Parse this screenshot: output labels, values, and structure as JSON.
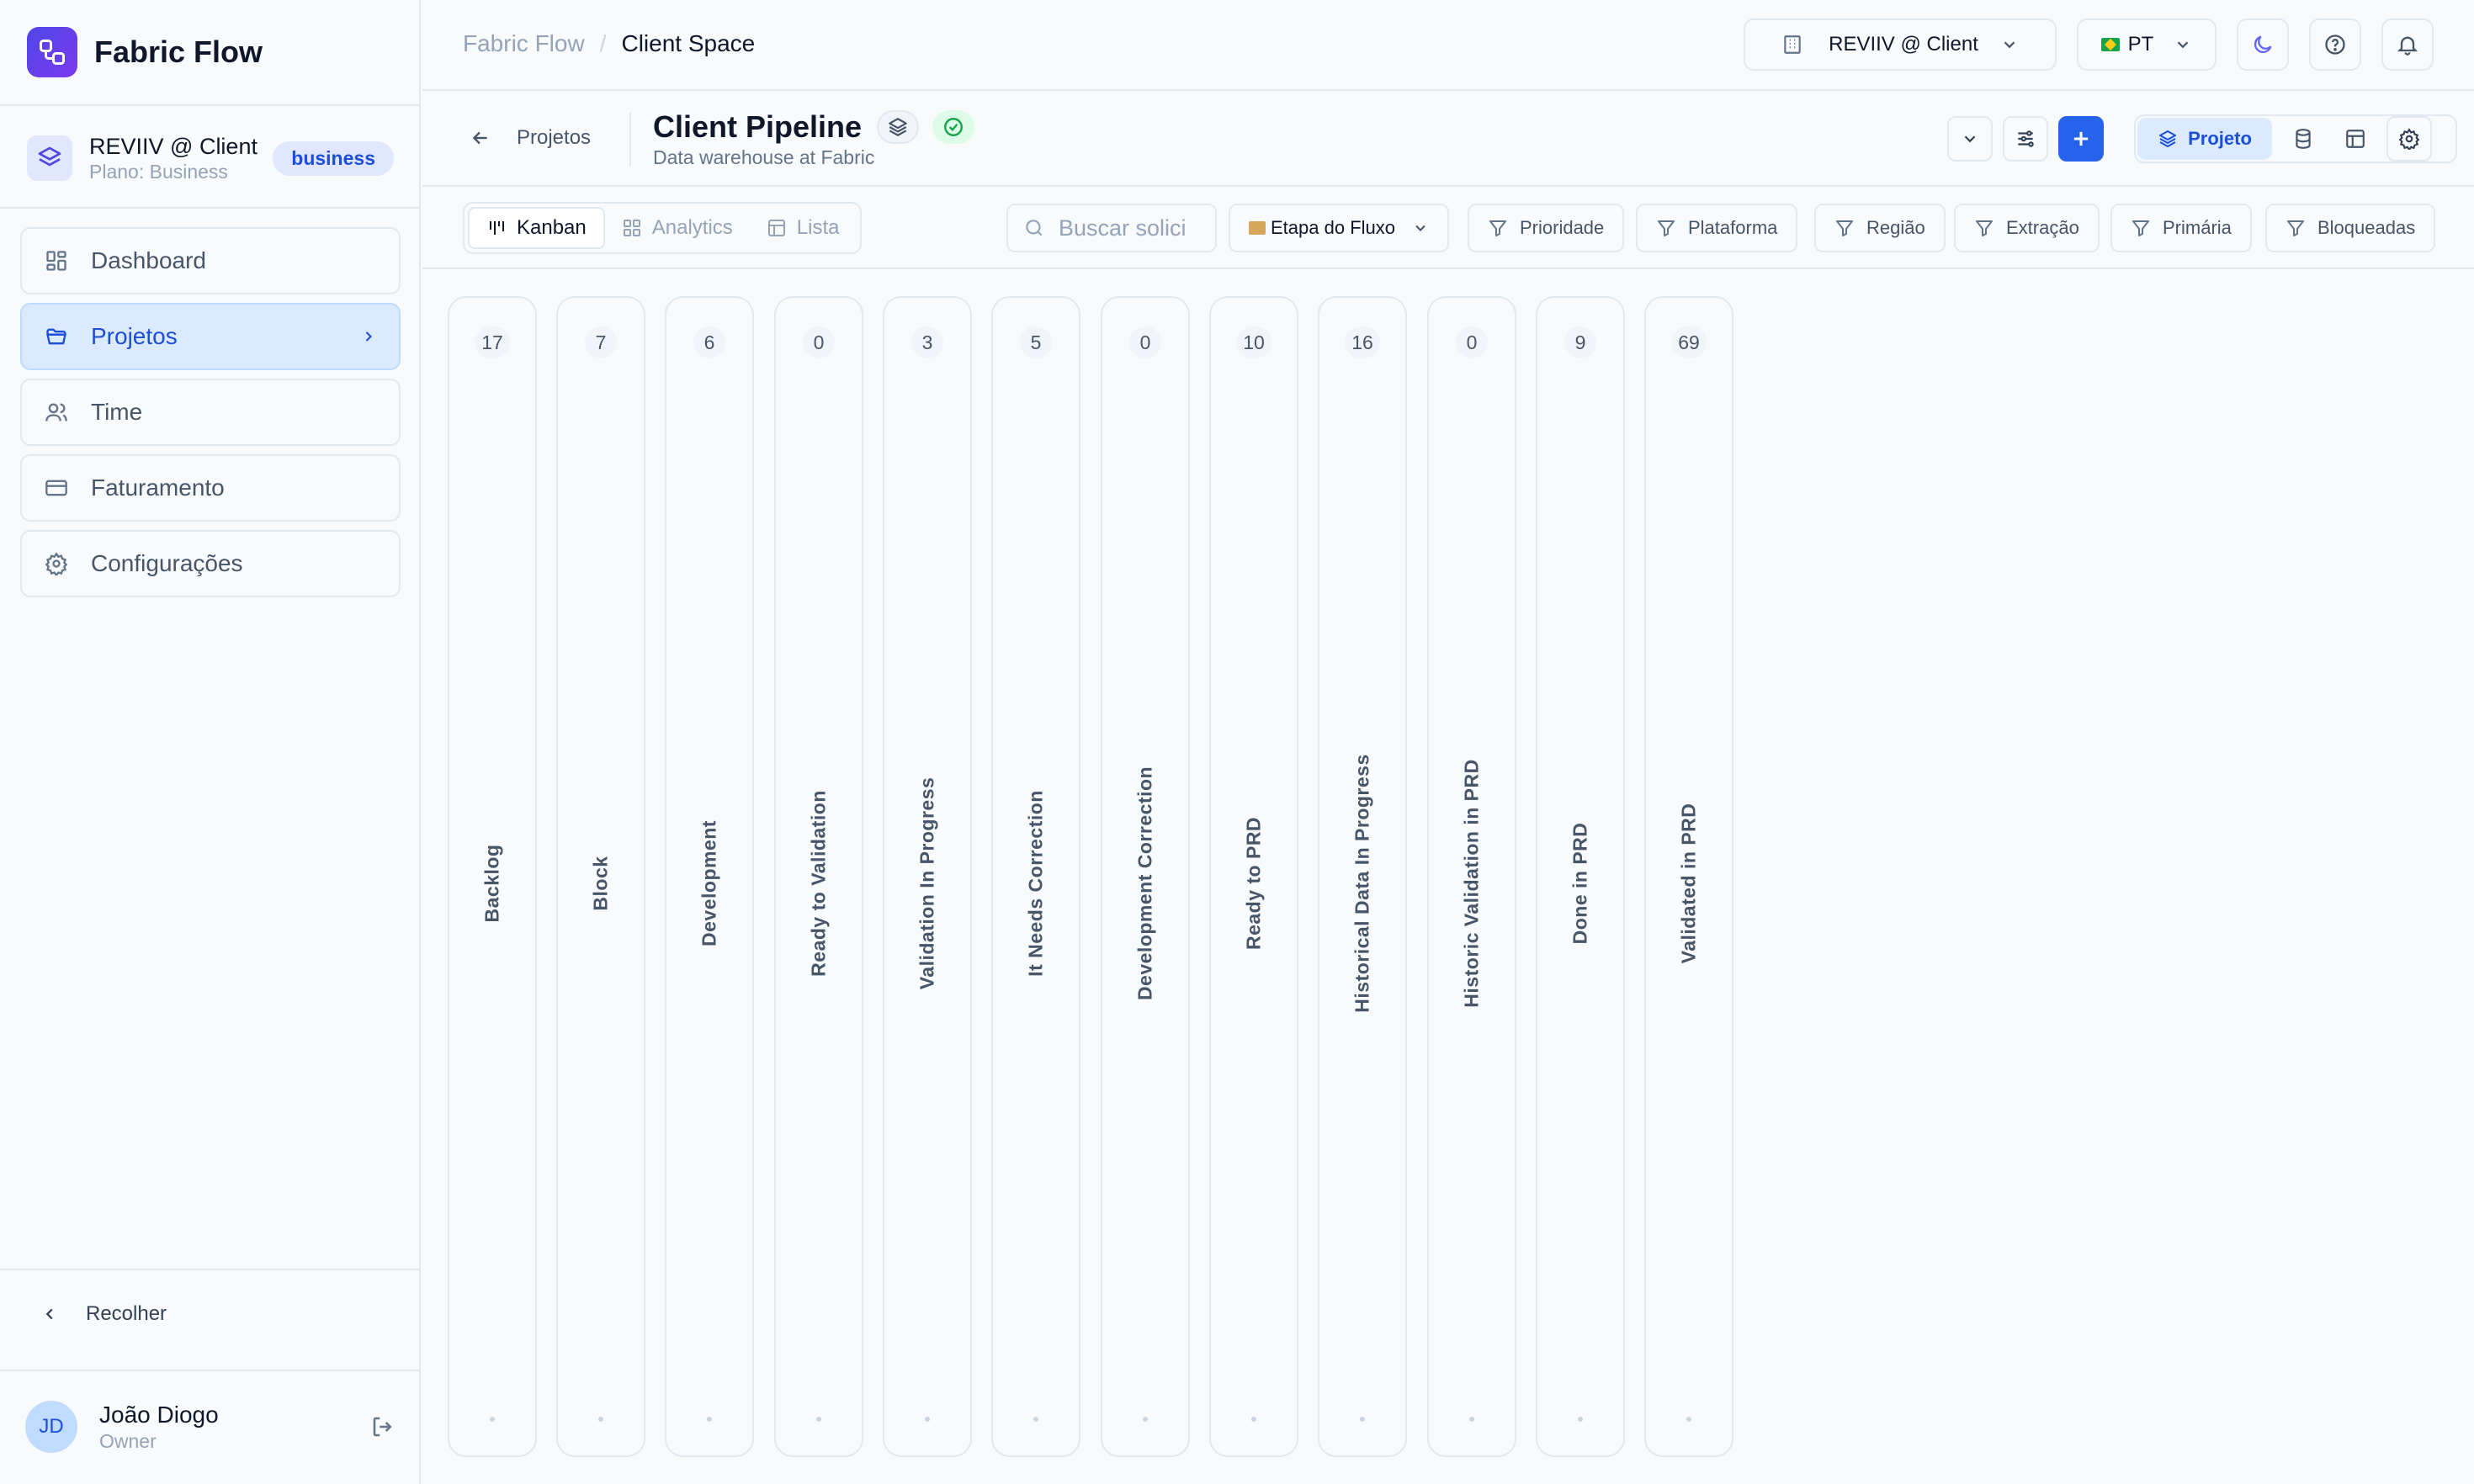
{
  "app": {
    "name": "Fabric Flow"
  },
  "workspace": {
    "name": "REVIIV @ Client",
    "plan": "Plano: Business",
    "badge": "business"
  },
  "sidebar": {
    "items": [
      {
        "label": "Dashboard",
        "icon": "dashboard-icon"
      },
      {
        "label": "Projetos",
        "icon": "folder-icon",
        "active": true
      },
      {
        "label": "Time",
        "icon": "users-icon"
      },
      {
        "label": "Faturamento",
        "icon": "credit-card-icon"
      },
      {
        "label": "Configurações",
        "icon": "gear-icon"
      }
    ],
    "collapse_label": "Recolher"
  },
  "user": {
    "initials": "JD",
    "name": "João Diogo",
    "role": "Owner"
  },
  "topbar": {
    "breadcrumb_root": "Fabric Flow",
    "breadcrumb_separator": "/",
    "breadcrumb_current": "Client Space",
    "workspace_select": "REVIIV @ Client",
    "language_select": "PT"
  },
  "project": {
    "back_label": "Projetos",
    "title": "Client Pipeline",
    "subtitle": "Data warehouse at Fabric",
    "view_mode": "Projeto"
  },
  "views": {
    "tabs": [
      {
        "label": "Kanban",
        "active": true
      },
      {
        "label": "Analytics"
      },
      {
        "label": "Lista"
      }
    ]
  },
  "filters": {
    "search_placeholder": "Buscar solici",
    "stage_select": "Etapa do Fluxo",
    "buttons": [
      "Prioridade",
      "Plataforma",
      "Região",
      "Extração",
      "Primária",
      "Bloqueadas"
    ]
  },
  "kanban": {
    "columns": [
      {
        "name": "Backlog",
        "count": "17"
      },
      {
        "name": "Block",
        "count": "7"
      },
      {
        "name": "Development",
        "count": "6"
      },
      {
        "name": "Ready to Validation",
        "count": "0"
      },
      {
        "name": "Validation In Progress",
        "count": "3"
      },
      {
        "name": "It Needs Correction",
        "count": "5"
      },
      {
        "name": "Development Correction",
        "count": "0"
      },
      {
        "name": "Ready to PRD",
        "count": "10"
      },
      {
        "name": "Historical Data In Progress",
        "count": "16"
      },
      {
        "name": "Historic Validation in PRD",
        "count": "0"
      },
      {
        "name": "Done in PRD",
        "count": "9"
      },
      {
        "name": "Validated in PRD",
        "count": "69"
      }
    ]
  },
  "colors": {
    "accent": "#2563eb",
    "active_bg": "#dbeafe",
    "brand_gradient_start": "#4f46e5",
    "brand_gradient_end": "#7c3aed",
    "success": "#16a34a"
  }
}
